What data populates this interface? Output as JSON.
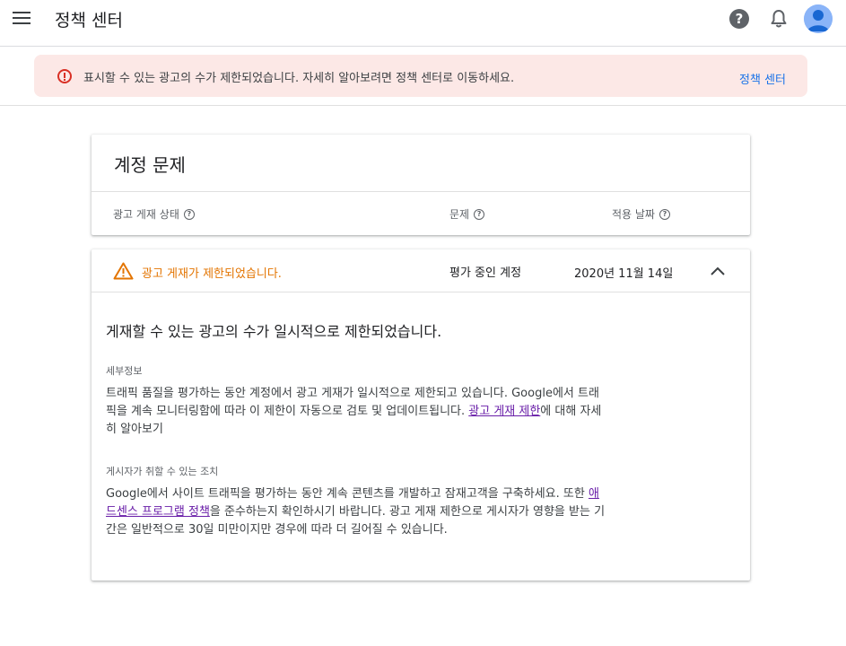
{
  "app": {
    "title": "정책 센터"
  },
  "alert": {
    "text": "표시할 수 있는 광고의 수가 제한되었습니다. 자세히 알아보려면 정책 센터로 이동하세요.",
    "link_label": "정책 센터"
  },
  "account_card": {
    "title": "계정 문제",
    "columns": [
      "광고 게재 상태",
      "문제",
      "적용 날짜"
    ]
  },
  "issue": {
    "status": "광고 게재가 제한되었습니다.",
    "problem": "평가 중인 계정",
    "date": "2020년 11월 14일",
    "headline": "게재할 수 있는 광고의 수가 일시적으로 제한되었습니다.",
    "details_label": "세부정보",
    "details_text_before": "트래픽 품질을 평가하는 동안 계정에서 광고 게재가 일시적으로 제한되고 있습니다. Google에서 트래픽을 계속 모니터링함에 따라 이 제한이 자동으로 검토 및 업데이트됩니다.",
    "details_link": "광고 게재 제한",
    "details_text_after": "에 대해 자세히 알아보기",
    "action_label": "게시자가 취할 수 있는 조치",
    "action_text_before": "Google에서 사이트 트래픽을 평가하는 동안 계속 콘텐츠를 개발하고 잠재고객을 구축하세요. 또한 ",
    "action_link": "애드센스 프로그램 정책",
    "action_text_after": "을 준수하는지 확인하시기 바랍니다. 광고 게재 제한으로 게시자가 영향을 받는 기간은 일반적으로 30일 미만이지만 경우에 따라 더 길어질 수 있습니다."
  },
  "colors": {
    "alert_bg": "#fce8e6",
    "alert_icon": "#d93025",
    "link": "#1a73e8",
    "warning": "#e37400",
    "visited_link": "#681da8"
  },
  "icons": [
    "menu-icon",
    "help-icon",
    "bell-icon",
    "avatar",
    "error-icon",
    "question-icon",
    "warning-icon",
    "chevron-up-icon"
  ]
}
